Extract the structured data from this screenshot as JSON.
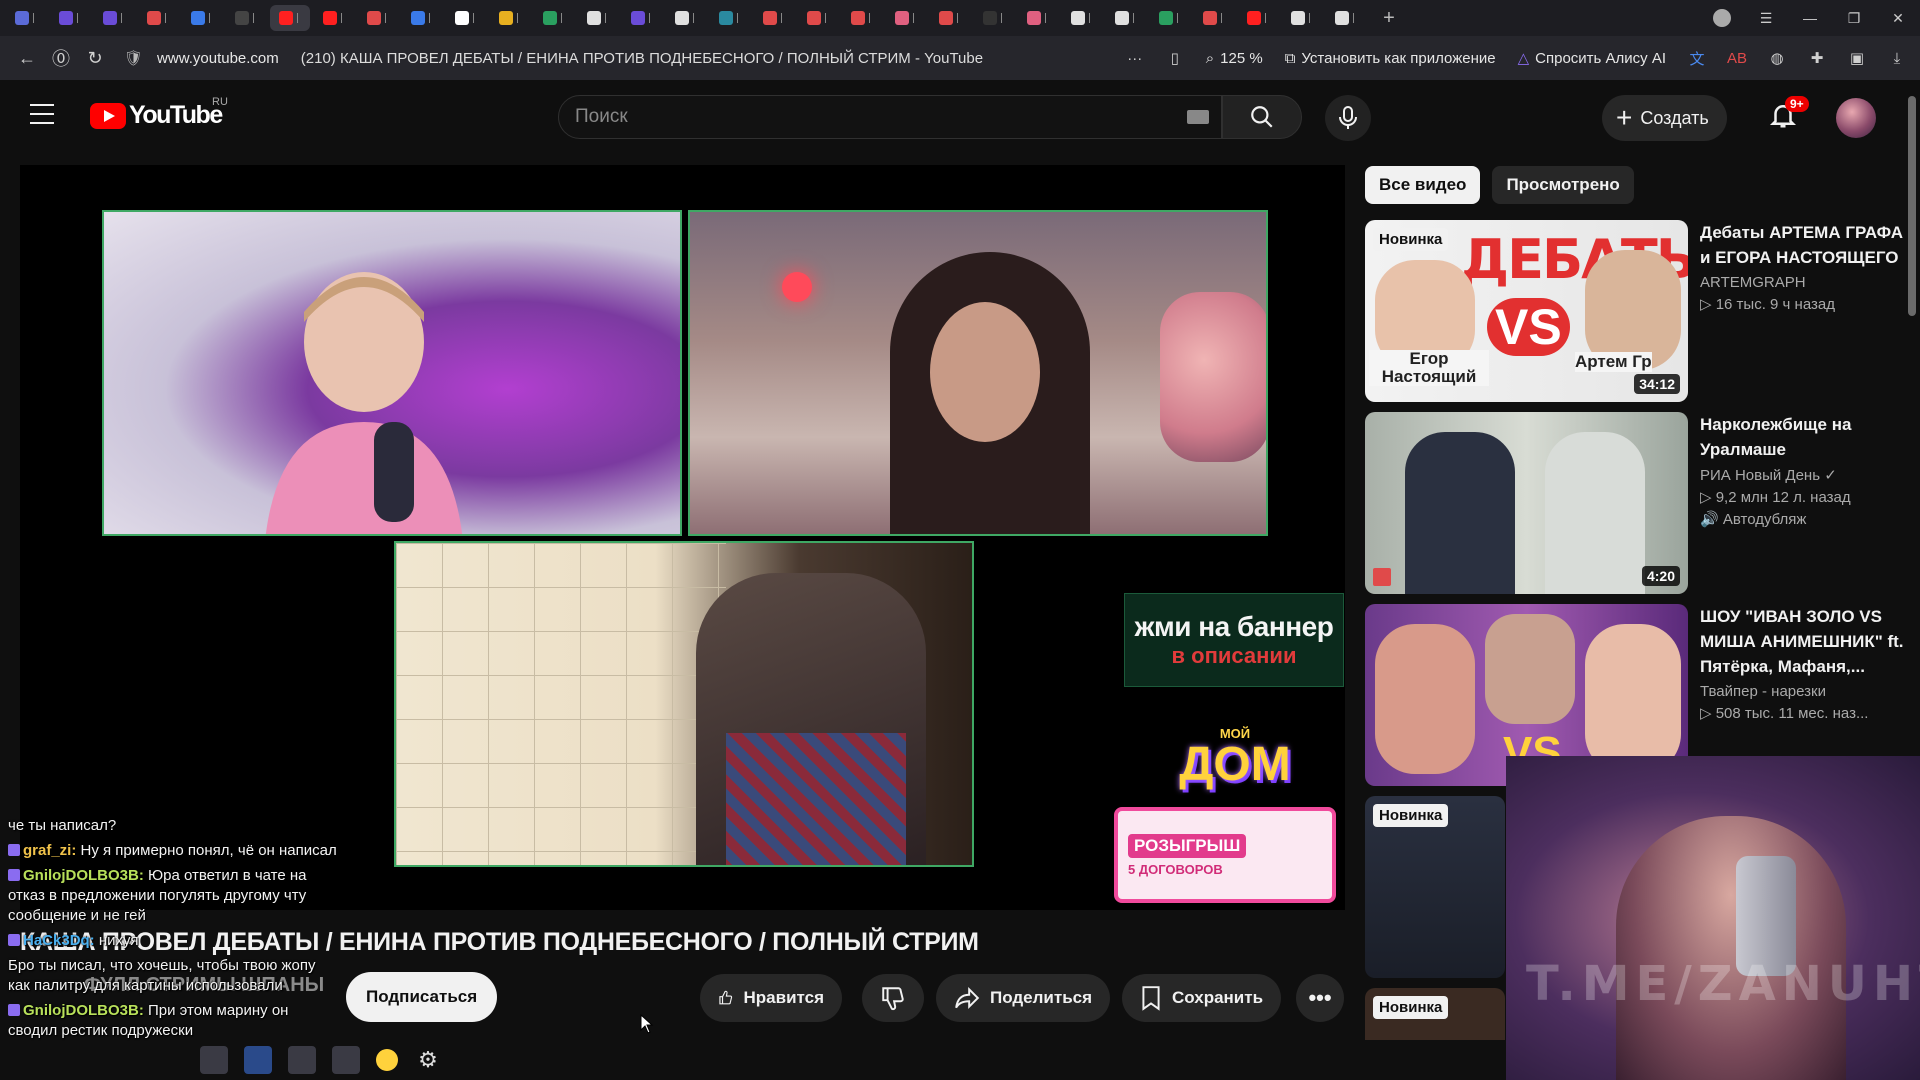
{
  "browser": {
    "tabs": [
      {
        "color": "#5b6bd8"
      },
      {
        "color": "#6a4cd8"
      },
      {
        "color": "#6a4cd8"
      },
      {
        "color": "#e04a4a"
      },
      {
        "color": "#3a7ae8"
      },
      {
        "color": "#444444"
      },
      {
        "color": "#ff2020",
        "active": true
      },
      {
        "color": "#ff2020"
      },
      {
        "color": "#e04a4a"
      },
      {
        "color": "#3a7ae8"
      },
      {
        "color": "#ffffff"
      },
      {
        "color": "#e8b020"
      },
      {
        "color": "#2aa060"
      },
      {
        "color": "#e0e0e0"
      },
      {
        "color": "#6a4cd8"
      },
      {
        "color": "#e0e0e0"
      },
      {
        "color": "#2a8aa0"
      },
      {
        "color": "#e04a4a"
      },
      {
        "color": "#e04a4a"
      },
      {
        "color": "#e04a4a"
      },
      {
        "color": "#e06080"
      },
      {
        "color": "#e04a4a"
      },
      {
        "color": "#333333"
      },
      {
        "color": "#e06080"
      },
      {
        "color": "#e0e0e0"
      },
      {
        "color": "#e0e0e0"
      },
      {
        "color": "#2aa060"
      },
      {
        "color": "#e04a4a"
      },
      {
        "color": "#ff2020"
      },
      {
        "color": "#e0e0e0"
      },
      {
        "color": "#e0e0e0"
      }
    ],
    "host": "www.youtube.com",
    "page_title": "(210) КАША ПРОВЕЛ ДЕБАТЫ / ЕНИНА ПРОТИВ ПОДНЕБЕСНОГО / ПОЛНЫЙ СТРИМ - YouTube",
    "zoom": "125 %",
    "install_app": "Установить как приложение",
    "ask_alice": "Спросить Алису AI"
  },
  "header": {
    "logo_text": "YouTube",
    "region": "RU",
    "search_placeholder": "Поиск",
    "create_label": "Создать",
    "notif_count": "9+"
  },
  "player": {
    "banner1_line1": "жми на баннер",
    "banner1_line2": "в описании",
    "banner2_line1": "МОЙ",
    "banner2_line2": "ДОМ",
    "banner3_line1": "РОЗЫГРЫШ",
    "banner3_line2": "5 ДОГОВОРОВ"
  },
  "video": {
    "title": "КАША ПРОВЕЛ ДЕБАТЫ / ЕНИНА ПРОТИВ ПОДНЕБЕСНОГО / ПОЛНЫЙ СТРИМ",
    "subscribe": "Подписаться",
    "like": "Нравится",
    "share": "Поделиться",
    "save": "Сохранить"
  },
  "sidebar": {
    "chips": [
      "Все видео",
      "Просмотрено"
    ],
    "items": [
      {
        "title": "Дебаты АРТЕМА ГРАФА и ЕГОРА НАСТОЯЩЕГО",
        "channel": "ARTEMGRAPH",
        "stats": "▷ 16 тыс.  9 ч назад",
        "badge": "Новинка",
        "duration": "34:12",
        "thumb_text1": "ДЕБАТЫ",
        "thumb_text2": "VS",
        "thumb_text3": "Егор Настоящий",
        "thumb_text4": "Артем Гр"
      },
      {
        "title": "Нарколежбище на Уралмаше",
        "channel": "РИА Новый День ✓",
        "stats": "▷ 9,2 млн  12 л. назад",
        "dub": "Автодубляж",
        "duration": "4:20"
      },
      {
        "title": "ШОУ \"ИВАН ЗОЛО VS МИША АНИМЕШНИК\" ft. Пятёрка, Мафаня,...",
        "channel": "Твайпер - нарезки",
        "stats": "▷ 508 тыс.  11 мес. наз...",
        "thumb_text2": "VS"
      },
      {
        "badge": "Новинка"
      },
      {
        "badge": "Новинка"
      }
    ]
  },
  "chat": [
    {
      "nick": "",
      "text": "че ты написал?",
      "color": "#f4f4f4"
    },
    {
      "nick": "graf_zi:",
      "text": " Ну я примерно понял, чё он написал",
      "color": "#f0c24a"
    },
    {
      "nick": "GnilojDOLBO3B:",
      "text": " Юра ответил в чате на отказ в предложении погулять другому чту сообщение и не гей",
      "color": "#b8e05a"
    },
    {
      "nick": "HaCk3Dq:",
      "text": " нихуя",
      "color": "#4ab0f0"
    },
    {
      "nick": "",
      "text": "Бро ты писал, что хочешь, чтобы твою жопу как палитру для картины использовали",
      "color": "#f4f4f4"
    },
    {
      "nick": "GnilojDOLBO3B:",
      "text": " При этом марину он сводил рестик подружески",
      "color": "#b8e05a"
    }
  ],
  "overlay": {
    "watermark": "T.ME/ZANUHTV",
    "stream_overlay": "ФУЛЛ СТРИМЫ ШПАНЫ"
  }
}
